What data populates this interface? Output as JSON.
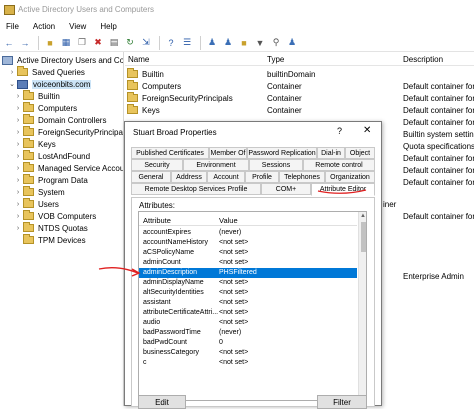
{
  "window": {
    "title": "Active Directory Users and Computers"
  },
  "menu": [
    "File",
    "Action",
    "View",
    "Help"
  ],
  "toolbar_icons": [
    "back-arrow-icon",
    "forward-arrow-icon",
    "up-folder-icon",
    "console-tree-icon",
    "copy-icon",
    "delete-icon",
    "properties-icon",
    "refresh-icon",
    "export-icon",
    "help-icon",
    "list-view-icon",
    "details-view-icon",
    "users-icon",
    "group-icon",
    "ou-icon",
    "filter-icon",
    "find-icon",
    "add-group-icon"
  ],
  "tree": {
    "root": "Active Directory Users and Com",
    "items": [
      {
        "label": "Saved Queries",
        "level": 1,
        "icon": "folder"
      },
      {
        "label": "voiceonbits.com",
        "level": 1,
        "icon": "domain",
        "selected": true
      },
      {
        "label": "Builtin",
        "level": 2,
        "icon": "folder"
      },
      {
        "label": "Computers",
        "level": 2,
        "icon": "folder"
      },
      {
        "label": "Domain Controllers",
        "level": 2,
        "icon": "folder"
      },
      {
        "label": "ForeignSecurityPrincipals",
        "level": 2,
        "icon": "folder"
      },
      {
        "label": "Keys",
        "level": 2,
        "icon": "folder"
      },
      {
        "label": "LostAndFound",
        "level": 2,
        "icon": "folder"
      },
      {
        "label": "Managed Service Accoun",
        "level": 2,
        "icon": "folder"
      },
      {
        "label": "Program Data",
        "level": 2,
        "icon": "folder"
      },
      {
        "label": "System",
        "level": 2,
        "icon": "folder"
      },
      {
        "label": "Users",
        "level": 2,
        "icon": "folder"
      },
      {
        "label": "VOB Computers",
        "level": 2,
        "icon": "folder"
      },
      {
        "label": "NTDS Quotas",
        "level": 2,
        "icon": "folder"
      },
      {
        "label": "TPM Devices",
        "level": 2,
        "icon": "folder"
      }
    ]
  },
  "list": {
    "headers": {
      "name": "Name",
      "type": "Type",
      "description": "Description"
    },
    "rows": [
      {
        "name": "Builtin",
        "type": "builtinDomain",
        "description": ""
      },
      {
        "name": "Computers",
        "type": "Container",
        "description": "Default container for"
      },
      {
        "name": "ForeignSecurityPrincipals",
        "type": "Container",
        "description": "Default container for"
      },
      {
        "name": "Keys",
        "type": "Container",
        "description": "Default container for"
      },
      {
        "name": "",
        "type": "",
        "description": "Default container for"
      },
      {
        "name": "",
        "type": "",
        "description": "Builtin system setting"
      },
      {
        "name": "",
        "type": "",
        "description": "Quota specifications"
      },
      {
        "name": "",
        "type": "",
        "description": "Default container for"
      },
      {
        "name": "",
        "type": "",
        "description": "Default container for"
      },
      {
        "name": "",
        "type": "",
        "description": "Default container for"
      },
      {
        "name": "",
        "type": "iner",
        "description": ""
      },
      {
        "name": "",
        "type": "",
        "description": "Default container for"
      },
      {
        "name": "",
        "type": "",
        "description": "Enterprise Admin"
      }
    ]
  },
  "dialog": {
    "title": "Stuart Broad Properties",
    "help": "?",
    "close": "✕",
    "tabs_row1": [
      "Published Certificates",
      "Member Of",
      "Password Replication",
      "Dial-in",
      "Object"
    ],
    "tabs_row2": [
      "Security",
      "Environment",
      "Sessions",
      "Remote control"
    ],
    "tabs_row3": [
      "General",
      "Address",
      "Account",
      "Profile",
      "Telephones",
      "Organization"
    ],
    "tabs_row4": [
      "Remote Desktop Services Profile",
      "COM+",
      "Attribute Editor"
    ],
    "active_tab": "Attribute Editor",
    "attributes_label": "Attributes:",
    "columns": {
      "attribute": "Attribute",
      "value": "Value"
    },
    "rows": [
      {
        "attribute": "accountExpires",
        "value": "(never)"
      },
      {
        "attribute": "accountNameHistory",
        "value": "<not set>"
      },
      {
        "attribute": "aCSPolicyName",
        "value": "<not set>"
      },
      {
        "attribute": "adminCount",
        "value": "<not set>"
      },
      {
        "attribute": "adminDescription",
        "value": "PHSFiltered",
        "selected": true
      },
      {
        "attribute": "adminDisplayName",
        "value": "<not set>"
      },
      {
        "attribute": "altSecurityIdentities",
        "value": "<not set>"
      },
      {
        "attribute": "assistant",
        "value": "<not set>"
      },
      {
        "attribute": "attributeCertificateAttri...",
        "value": "<not set>"
      },
      {
        "attribute": "audio",
        "value": "<not set>"
      },
      {
        "attribute": "badPasswordTime",
        "value": "(never)"
      },
      {
        "attribute": "badPwdCount",
        "value": "0"
      },
      {
        "attribute": "businessCategory",
        "value": "<not set>"
      },
      {
        "attribute": "c",
        "value": "<not set>"
      }
    ],
    "buttons": {
      "edit": "Edit",
      "filter": "Filter"
    }
  },
  "annotation_color": "#e02020"
}
